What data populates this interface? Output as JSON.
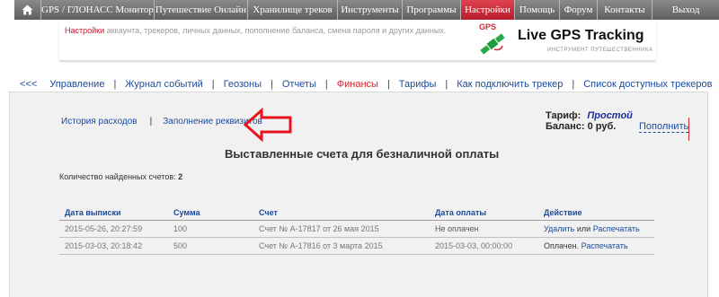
{
  "top_menu": [
    {
      "label": "",
      "icon": "home-icon"
    },
    {
      "label": "GPS / ГЛОНАСС Мониторинг"
    },
    {
      "label": "Путешествие Онлайн"
    },
    {
      "label": "Хранилище треков"
    },
    {
      "label": "Инструменты"
    },
    {
      "label": "Программы"
    },
    {
      "label": "Настройки",
      "active": true
    },
    {
      "label": "Помощь"
    },
    {
      "label": "Форум"
    },
    {
      "label": "Контакты"
    },
    {
      "label": "Выход"
    }
  ],
  "header": {
    "section_name": "Настройки",
    "description": " аккаунта, трекеров, личных данных, пополнение баланса, смена пароля и других данных.",
    "logo_badge": "GPS",
    "logo_title": "Live GPS Tracking",
    "logo_subtitle": "ИНСТРУМЕНТ ПУТЕШЕСТВЕННИКА"
  },
  "subnav": {
    "back": "<<<",
    "items": [
      {
        "label": "Управление"
      },
      {
        "label": "Журнал событий"
      },
      {
        "label": "Геозоны"
      },
      {
        "label": "Отчеты"
      },
      {
        "label": "Финансы",
        "active": true
      },
      {
        "label": "Тарифы"
      },
      {
        "label": "Как подключить трекер"
      },
      {
        "label": "Список доступных трекеров"
      }
    ]
  },
  "finance": {
    "links": [
      "История расходов",
      "Заполнение реквизитов"
    ],
    "separator": "|",
    "tariff_label": "Тариф:",
    "tariff_value": "Простой",
    "balance_label": "Баланс:",
    "balance_value": "0 руб.",
    "topup_label": "Пополнить",
    "title": "Выставленные счета для безналичной оплаты",
    "found_label": "Количество найденных счетов:",
    "found_count": "2"
  },
  "invoices": {
    "headers": [
      "Дата выписки",
      "Сумма",
      "Счет",
      "Дата оплаты",
      "Действие"
    ],
    "rows": [
      {
        "date": "2015-05-26, 20:27:59",
        "sum": "100",
        "invoice": "Счет № А-17817 от 26 мая 2015",
        "paid": "Не оплачен",
        "action_delete": "Удалить",
        "action_or": "или",
        "action_print": "Распечатать"
      },
      {
        "date": "2015-03-03, 20:18:42",
        "sum": "500",
        "invoice": "Счет № А-17816 от 3 марта 2015",
        "paid": "2015-03-03, 00:00:00",
        "action_status": "Оплачен.",
        "action_print": "Распечатать"
      }
    ]
  },
  "colors": {
    "accent_red": "#cc2a36",
    "link_blue": "#1a4a9c",
    "menu_gray": "#6b6b6b",
    "annotation_arrow": "#e8131c"
  }
}
